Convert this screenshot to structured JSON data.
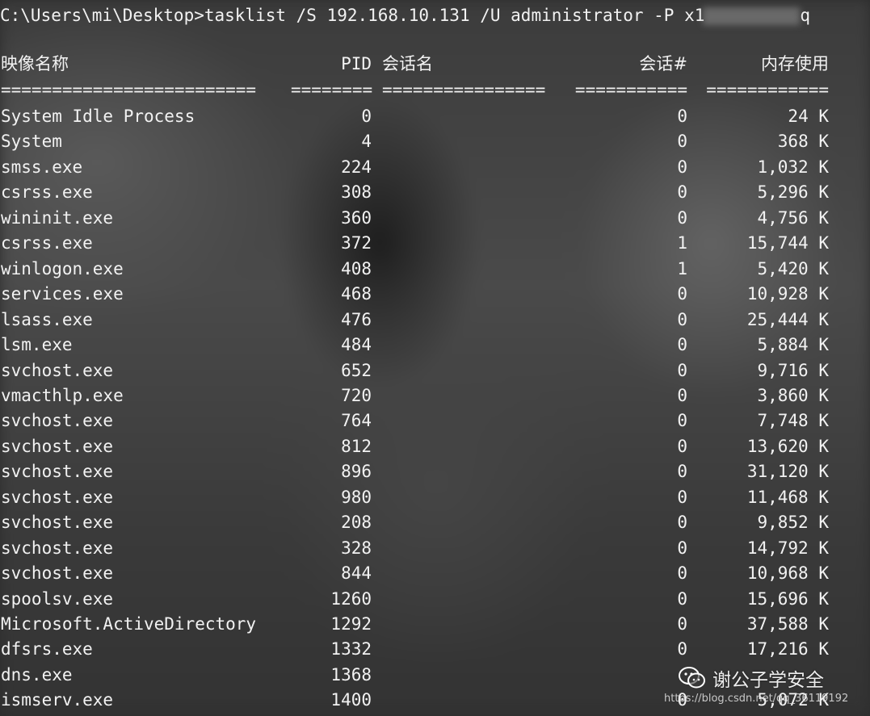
{
  "console": {
    "command": "C:\\Users\\mi\\Desktop>tasklist /S 192.168.10.131 /U administrator -P x1",
    "password_tail": "q"
  },
  "headers": {
    "image_name": "映像名称",
    "pid": "PID",
    "session_name": "会话名",
    "session_num": "会话#",
    "mem_usage": "内存使用"
  },
  "separator": {
    "image_name": "=========================",
    "pid": "========",
    "session_name": "================",
    "session_num": "===========",
    "mem_usage": "============"
  },
  "processes": [
    {
      "name": "System Idle Process",
      "pid": "0",
      "session_name": "",
      "session_num": "0",
      "mem": "24 K"
    },
    {
      "name": "System",
      "pid": "4",
      "session_name": "",
      "session_num": "0",
      "mem": "368 K"
    },
    {
      "name": "smss.exe",
      "pid": "224",
      "session_name": "",
      "session_num": "0",
      "mem": "1,032 K"
    },
    {
      "name": "csrss.exe",
      "pid": "308",
      "session_name": "",
      "session_num": "0",
      "mem": "5,296 K"
    },
    {
      "name": "wininit.exe",
      "pid": "360",
      "session_name": "",
      "session_num": "0",
      "mem": "4,756 K"
    },
    {
      "name": "csrss.exe",
      "pid": "372",
      "session_name": "",
      "session_num": "1",
      "mem": "15,744 K"
    },
    {
      "name": "winlogon.exe",
      "pid": "408",
      "session_name": "",
      "session_num": "1",
      "mem": "5,420 K"
    },
    {
      "name": "services.exe",
      "pid": "468",
      "session_name": "",
      "session_num": "0",
      "mem": "10,928 K"
    },
    {
      "name": "lsass.exe",
      "pid": "476",
      "session_name": "",
      "session_num": "0",
      "mem": "25,444 K"
    },
    {
      "name": "lsm.exe",
      "pid": "484",
      "session_name": "",
      "session_num": "0",
      "mem": "5,884 K"
    },
    {
      "name": "svchost.exe",
      "pid": "652",
      "session_name": "",
      "session_num": "0",
      "mem": "9,716 K"
    },
    {
      "name": "vmacthlp.exe",
      "pid": "720",
      "session_name": "",
      "session_num": "0",
      "mem": "3,860 K"
    },
    {
      "name": "svchost.exe",
      "pid": "764",
      "session_name": "",
      "session_num": "0",
      "mem": "7,748 K"
    },
    {
      "name": "svchost.exe",
      "pid": "812",
      "session_name": "",
      "session_num": "0",
      "mem": "13,620 K"
    },
    {
      "name": "svchost.exe",
      "pid": "896",
      "session_name": "",
      "session_num": "0",
      "mem": "31,120 K"
    },
    {
      "name": "svchost.exe",
      "pid": "980",
      "session_name": "",
      "session_num": "0",
      "mem": "11,468 K"
    },
    {
      "name": "svchost.exe",
      "pid": "208",
      "session_name": "",
      "session_num": "0",
      "mem": "9,852 K"
    },
    {
      "name": "svchost.exe",
      "pid": "328",
      "session_name": "",
      "session_num": "0",
      "mem": "14,792 K"
    },
    {
      "name": "svchost.exe",
      "pid": "844",
      "session_name": "",
      "session_num": "0",
      "mem": "10,968 K"
    },
    {
      "name": "spoolsv.exe",
      "pid": "1260",
      "session_name": "",
      "session_num": "0",
      "mem": "15,696 K"
    },
    {
      "name": "Microsoft.ActiveDirectory",
      "pid": "1292",
      "session_name": "",
      "session_num": "0",
      "mem": "37,588 K"
    },
    {
      "name": "dfsrs.exe",
      "pid": "1332",
      "session_name": "",
      "session_num": "0",
      "mem": "17,216 K"
    },
    {
      "name": "dns.exe",
      "pid": "1368",
      "session_name": "",
      "session_num": "",
      "mem": ""
    },
    {
      "name": "ismserv.exe",
      "pid": "1400",
      "session_name": "",
      "session_num": "0",
      "mem": "5,072 K"
    }
  ],
  "watermark": {
    "icon": "wechat-icon",
    "text": "谢公子学安全",
    "url": "https://blog.csdn.net/qq_36119192"
  }
}
